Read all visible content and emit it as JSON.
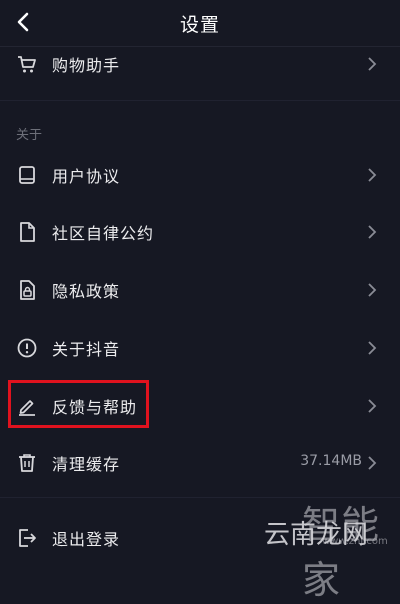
{
  "header": {
    "title": "设置"
  },
  "items_top": [
    {
      "label": "购物助手",
      "icon": "cart-icon"
    }
  ],
  "section_about": {
    "title": "关于"
  },
  "items_about": [
    {
      "label": "用户协议",
      "icon": "book-icon"
    },
    {
      "label": "社区自律公约",
      "icon": "document-icon"
    },
    {
      "label": "隐私政策",
      "icon": "lock-document-icon"
    },
    {
      "label": "关于抖音",
      "icon": "info-icon"
    },
    {
      "label": "反馈与帮助",
      "icon": "pen-icon"
    },
    {
      "label": "清理缓存",
      "icon": "trash-icon",
      "value": "37.14MB"
    }
  ],
  "logout": {
    "label": "退出登录",
    "icon": "logout-icon"
  },
  "watermark": {
    "brand": "智能家",
    "site": "云南龙网",
    "url": "www.znj.com"
  },
  "colors": {
    "background": "#161823",
    "highlight": "#e0121e"
  }
}
